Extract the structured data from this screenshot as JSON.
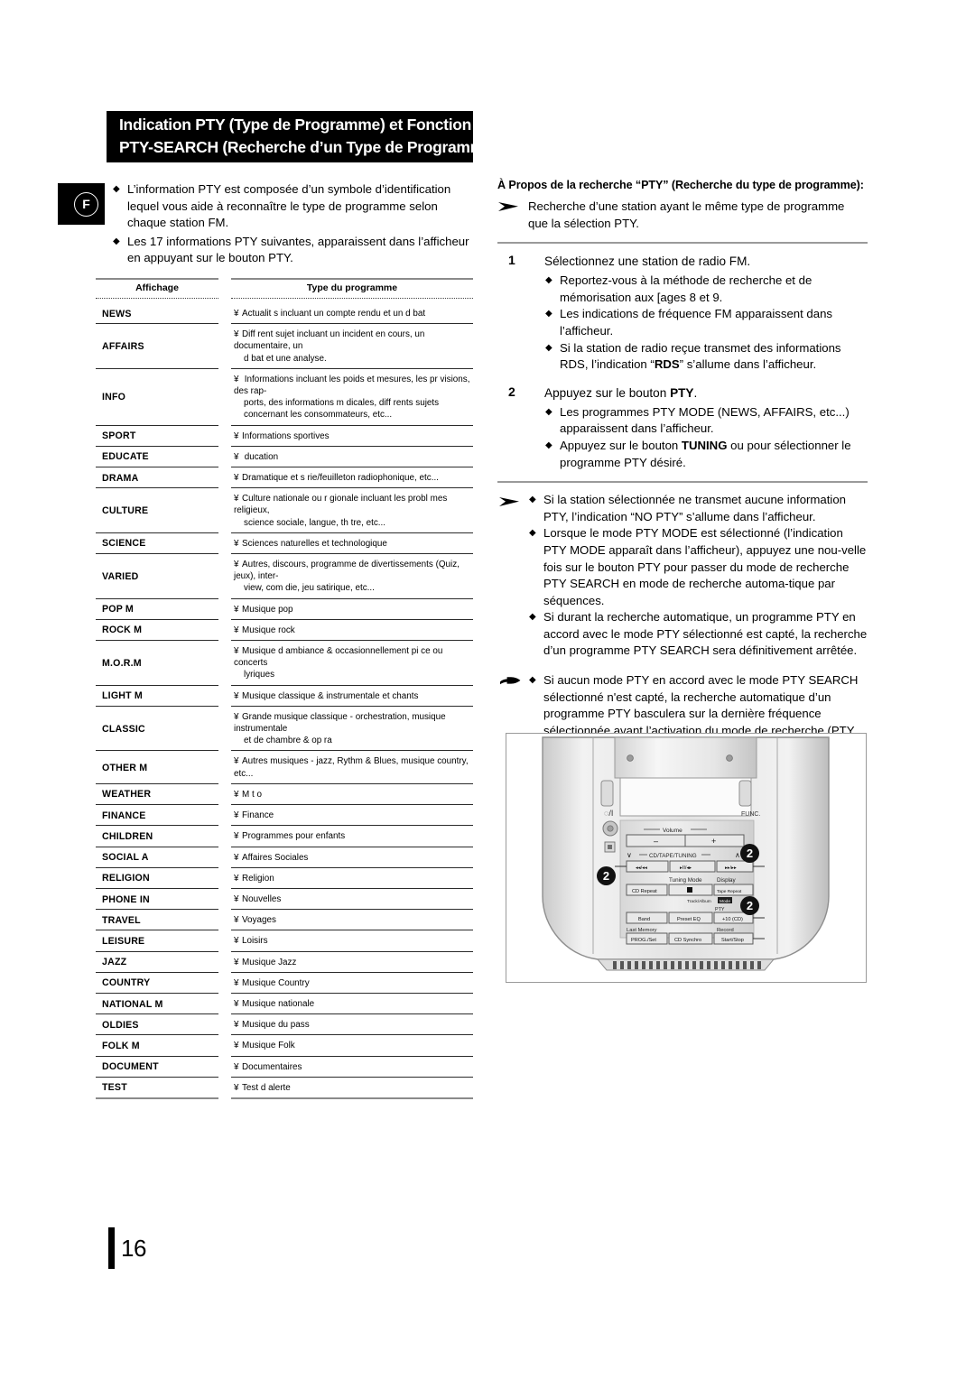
{
  "title": {
    "line1": "Indication PTY (Type de Programme) et Fonction",
    "line2": "PTY-SEARCH (Recherche d’un Type de Programme)"
  },
  "language_badge": {
    "letter": "F"
  },
  "left": {
    "intro": [
      "L’information PTY est composée d’un symbole d’identification lequel vous aide à reconnaître le type de programme selon chaque station FM.",
      "Les 17 informations PTY suivantes, apparaissent dans l’afficheur en appuyant sur le bouton PTY."
    ]
  },
  "table": {
    "headers": {
      "code": "Affichage",
      "desc": "Type du programme"
    },
    "marker": "¥",
    "rows": [
      {
        "code": "NEWS",
        "desc": "Actualit s incluant un compte rendu et un d bat"
      },
      {
        "code": "AFFAIRS",
        "desc": "Diff rent sujet incluant un incident en cours, un documentaire, un",
        "desc2": "d bat et une analyse."
      },
      {
        "code": "INFO",
        "desc": " Informations incluant les poids et mesures, les pr visions, des rap-",
        "desc2": "ports, des informations m dicales, diff rents sujets",
        "desc3": "concernant les consommateurs, etc..."
      },
      {
        "code": "SPORT",
        "desc": "Informations sportives"
      },
      {
        "code": "EDUCATE",
        "desc": " ducation"
      },
      {
        "code": "DRAMA",
        "desc": "Dramatique et s rie/feuilleton radiophonique, etc..."
      },
      {
        "code": "CULTURE",
        "desc": "Culture nationale ou r gionale incluant les probl mes religieux,",
        "desc2": "science sociale, langue, th tre, etc..."
      },
      {
        "code": "SCIENCE",
        "desc": "Sciences naturelles et technologique"
      },
      {
        "code": "VARIED",
        "desc": "Autres, discours, programme de divertissements (Quiz, jeux), inter-",
        "desc2": "view, com die, jeu satirique, etc..."
      },
      {
        "code": "POP M",
        "desc": "Musique pop"
      },
      {
        "code": "ROCK M",
        "desc": "Musique rock"
      },
      {
        "code": "M.O.R.M",
        "desc": "Musique d ambiance & occasionnellement pi ce ou concerts",
        "desc2": "lyriques"
      },
      {
        "code": "LIGHT M",
        "desc": "Musique classique & instrumentale et chants"
      },
      {
        "code": "CLASSIC",
        "desc": "Grande musique classique - orchestration, musique instrumentale",
        "desc2": "et de chambre & op ra"
      },
      {
        "code": "OTHER M",
        "desc": "Autres musiques - jazz, Rythm & Blues, musique country, etc..."
      },
      {
        "code": "WEATHER",
        "desc": "M t o"
      },
      {
        "code": "FINANCE",
        "desc": "Finance"
      },
      {
        "code": "CHILDREN",
        "desc": "Programmes pour enfants"
      },
      {
        "code": "SOCIAL  A",
        "desc": "Affaires Sociales"
      },
      {
        "code": "RELIGION",
        "desc": "Religion"
      },
      {
        "code": "PHONE IN",
        "desc": "Nouvelles"
      },
      {
        "code": "TRAVEL",
        "desc": "Voyages"
      },
      {
        "code": "LEISURE",
        "desc": "Loisirs"
      },
      {
        "code": "JAZZ",
        "desc": "Musique Jazz"
      },
      {
        "code": "COUNTRY",
        "desc": "Musique Country"
      },
      {
        "code": "NATIONAL M",
        "desc": "Musique nationale"
      },
      {
        "code": "OLDIES",
        "desc": "Musique du pass"
      },
      {
        "code": "FOLK M",
        "desc": "Musique Folk"
      },
      {
        "code": "DOCUMENT",
        "desc": "Documentaires"
      },
      {
        "code": "TEST",
        "desc": "Test d alerte"
      }
    ]
  },
  "right": {
    "heading": "À Propos de la recherche “PTY” (Recherche du type de programme):",
    "intro": "Recherche d’une station ayant le même type de programme que la sélection PTY.",
    "step1": {
      "num": "1",
      "lead": "Sélectionnez une station de radio FM.",
      "bullets": [
        "Reportez-vous à la méthode de recherche et de mémorisation aux [ages 8 et 9.",
        "Les indications de fréquence FM apparaissent dans l’afficheur."
      ],
      "bullet_rds_a": "Si la station de radio reçue transmet des informations RDS, l’indication “",
      "bullet_rds_kw": "RDS",
      "bullet_rds_b": "” s’allume dans l’afficheur."
    },
    "step2": {
      "num": "2",
      "lead_a": "Appuyez sur le bouton ",
      "lead_kw": "PTY",
      "lead_b": ".",
      "bullet1": "Les programmes PTY MODE (NEWS, AFFAIRS, etc...) apparaissent dans l’afficheur.",
      "bullet2_a": "Appuyez sur le bouton ",
      "bullet2_kw": "TUNING",
      "bullet2_b": "     ou       pour sélectionner le programme PTY désiré."
    },
    "notes": [
      "Si la station sélectionnée ne transmet aucune information PTY, l’indication “NO PTY” s’allume dans l’afficheur.",
      "Lorsque le mode PTY MODE est sélectionné (l’indication PTY MODE apparaît dans l’afficheur), appuyez une nou-velle fois sur le bouton PTY pour passer du mode de recherche PTY SEARCH en mode de recherche automa-tique par séquences.",
      "Si durant la recherche automatique, un programme PTY en accord avec le mode PTY sélectionné est capté, la recherche d’un programme PTY SEARCH sera définitivement arrêtée."
    ],
    "hand_note": "Si aucun mode PTY en accord avec le mode PTY SEARCH sélectionné n'est capté, la recherche automatique d’un programme PTY basculera sur la dernière fréquence sélectionnée avant l’activation du mode de recherche (PTY SEARCH)."
  },
  "device": {
    "power_label": "⏻/I",
    "func_label": "FUNC.",
    "volume_label": "Volume",
    "volume_minus": "–",
    "volume_plus": "+",
    "tuning_label": "CD/TAPE/TUNING",
    "down_chevron": "∨",
    "up_chevron": "∧",
    "transport": [
      "◂◂/◂◂",
      "▸II/◂▸",
      "▸▸/▸▸"
    ],
    "tuning_mode_label": "Tuning Mode",
    "display_label": "Display",
    "cd_repeat": "CD Repeat",
    "stop_btn": "■",
    "tape_repeat": "Tape Repeat",
    "track_album": "Track/Album",
    "mode_btn": "Mode",
    "pty_label": "PTY",
    "band": "Band",
    "preset_eq": "Preset EQ",
    "plus10": "+10 (CD)",
    "last_memory": "Last Memory",
    "record": "Record",
    "prog_set": "PROG./Set",
    "cd_synchro": "CD Synchro",
    "start_stop": "Start/Stop",
    "callouts": [
      "2",
      "2",
      "2"
    ]
  },
  "page": {
    "number": "16"
  }
}
